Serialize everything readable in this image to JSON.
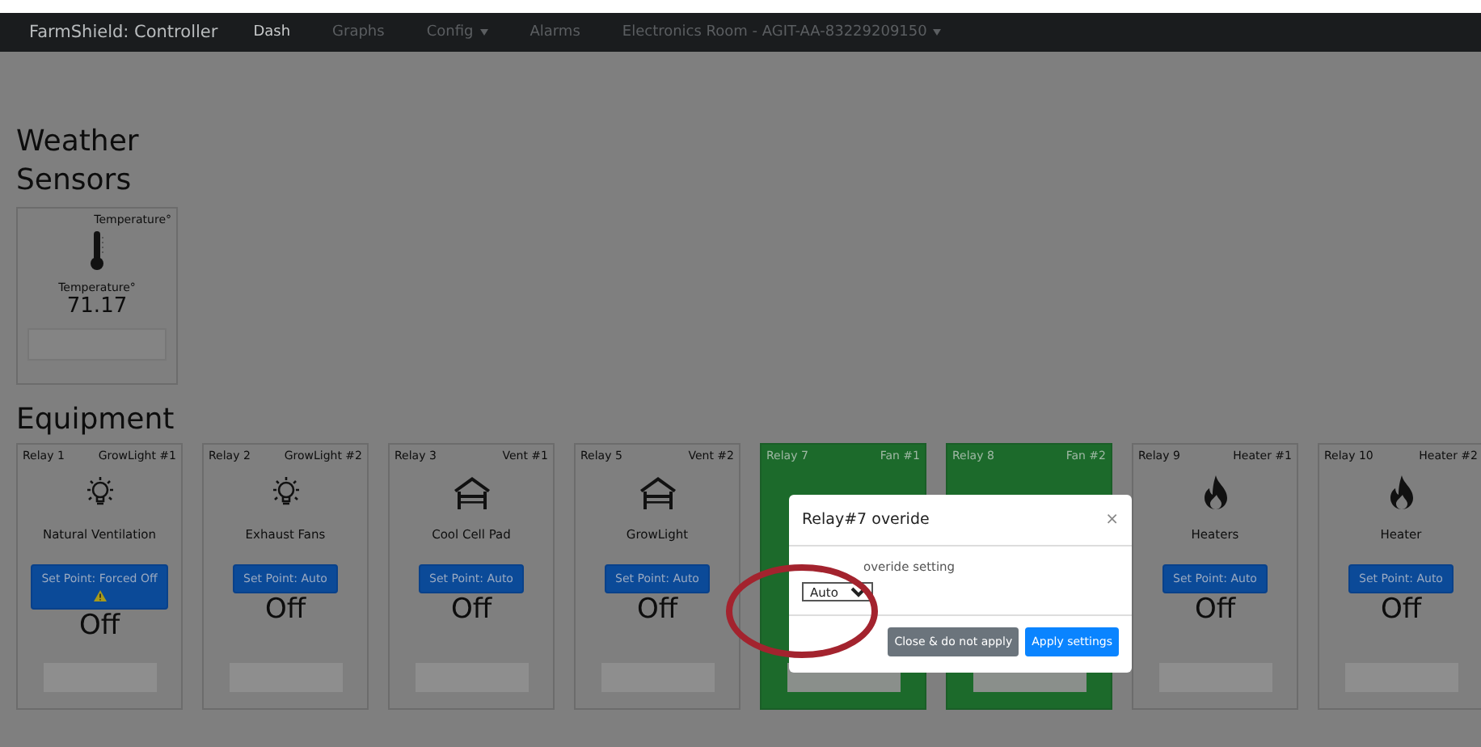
{
  "navbar": {
    "brand": "FarmShield: Controller",
    "items": [
      {
        "label": "Dash",
        "selected": true,
        "dropdown": false
      },
      {
        "label": "Graphs",
        "selected": false,
        "dropdown": false
      },
      {
        "label": "Config",
        "selected": false,
        "dropdown": true
      },
      {
        "label": "Alarms",
        "selected": false,
        "dropdown": false
      },
      {
        "label": "Electronics Room - AGIT-AA-83229209150",
        "selected": false,
        "dropdown": true
      }
    ]
  },
  "weather_heading": "Weather",
  "sensors_heading": "Sensors",
  "sensors": [
    {
      "corner": "Temperature°",
      "label": "Temperature°",
      "value": "71.17"
    }
  ],
  "equipment_heading": "Equipment",
  "relays": [
    {
      "relay": "Relay 1",
      "tag": "GrowLight #1",
      "kind": "light",
      "name": "Natural Ventilation",
      "setpoint": "Set Point: Forced Off",
      "warning": true,
      "state": "Off",
      "on": false
    },
    {
      "relay": "Relay 2",
      "tag": "GrowLight #2",
      "kind": "light",
      "name": "Exhaust Fans",
      "setpoint": "Set Point: Auto",
      "warning": false,
      "state": "Off",
      "on": false
    },
    {
      "relay": "Relay 3",
      "tag": "Vent #1",
      "kind": "vent",
      "name": "Cool Cell Pad",
      "setpoint": "Set Point: Auto",
      "warning": false,
      "state": "Off",
      "on": false
    },
    {
      "relay": "Relay 5",
      "tag": "Vent #2",
      "kind": "vent",
      "name": "GrowLight",
      "setpoint": "Set Point: Auto",
      "warning": false,
      "state": "Off",
      "on": false
    },
    {
      "relay": "Relay 7",
      "tag": "Fan #1",
      "on": true
    },
    {
      "relay": "Relay 8",
      "tag": "Fan #2",
      "on": true
    },
    {
      "relay": "Relay 9",
      "tag": "Heater #1",
      "kind": "heater",
      "name": "Heaters",
      "setpoint": "Set Point: Auto",
      "warning": false,
      "state": "Off",
      "on": false
    },
    {
      "relay": "Relay 10",
      "tag": "Heater #2",
      "kind": "heater",
      "name": "Heater",
      "setpoint": "Set Point: Auto",
      "warning": false,
      "state": "Off",
      "on": false
    }
  ],
  "modal": {
    "title": "Relay#7 overide",
    "close": "×",
    "label": "overide setting",
    "select": "Auto",
    "buttons": [
      {
        "label": "Close & do not apply",
        "kind": "secondary"
      },
      {
        "label": "Apply settings",
        "kind": "primary"
      }
    ]
  }
}
